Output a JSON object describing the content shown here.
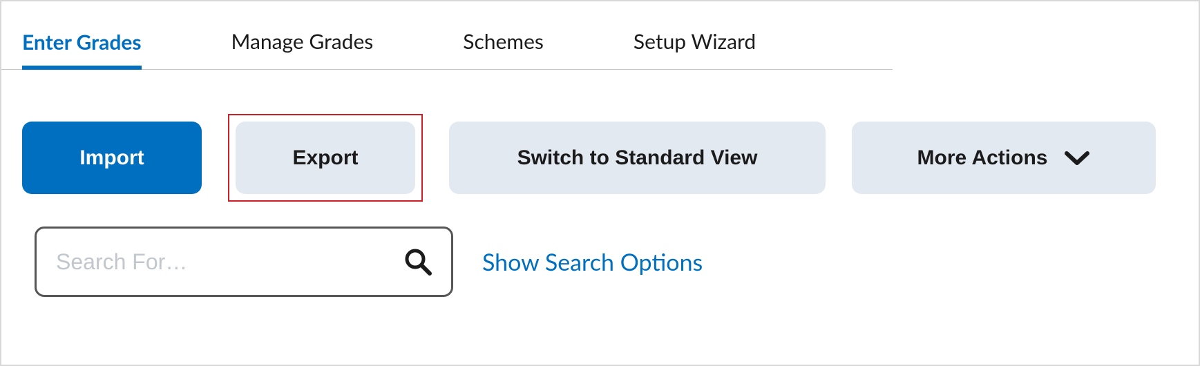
{
  "tabs": {
    "enter_grades": "Enter Grades",
    "manage_grades": "Manage Grades",
    "schemes": "Schemes",
    "setup_wizard": "Setup Wizard"
  },
  "toolbar": {
    "import_label": "Import",
    "export_label": "Export",
    "switch_view_label": "Switch to Standard View",
    "more_actions_label": "More Actions"
  },
  "search": {
    "placeholder": "Search For…",
    "value": "",
    "options_link": "Show Search Options"
  }
}
